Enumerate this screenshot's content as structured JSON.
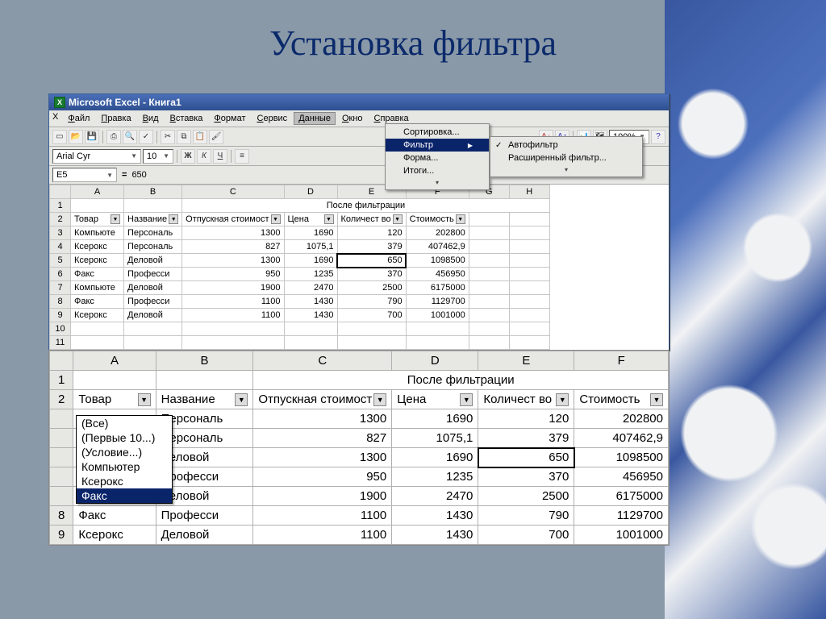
{
  "slide": {
    "title": "Установка фильтра"
  },
  "app": {
    "title": "Microsoft Excel - Книга1",
    "menu": [
      "Файл",
      "Правка",
      "Вид",
      "Вставка",
      "Формат",
      "Сервис",
      "Данные",
      "Окно",
      "Справка"
    ],
    "active_menu_index": 6,
    "font_name": "Arial Cyr",
    "font_size": "10",
    "zoom": "100%",
    "namebox": "E5",
    "formula_value": "650"
  },
  "data_menu": {
    "items": [
      {
        "label": "Сортировка..."
      },
      {
        "label": "Фильтр",
        "submenu": true,
        "highlight": true
      },
      {
        "label": "Форма..."
      },
      {
        "label": "Итоги..."
      }
    ],
    "submenu": [
      {
        "label": "Автофильтр",
        "checked": true
      },
      {
        "label": "Расширенный фильтр..."
      }
    ]
  },
  "sheet1": {
    "cols": [
      "A",
      "B",
      "C",
      "D",
      "E",
      "F",
      "G",
      "H"
    ],
    "title_row": "После фильтрации",
    "headers": [
      "Товар",
      "Название",
      "Отпускная стоимост",
      "Цена",
      "Количест во",
      "Стоимость"
    ],
    "rows": [
      {
        "n": "3",
        "товар": "Компьюте",
        "название": "Персональ",
        "отп": "1300",
        "цена": "1690",
        "кол": "120",
        "стоим": "202800"
      },
      {
        "n": "4",
        "товар": "Ксерокс",
        "название": "Персональ",
        "отп": "827",
        "цена": "1075,1",
        "кол": "379",
        "стоим": "407462,9"
      },
      {
        "n": "5",
        "товар": "Ксерокс",
        "название": "Деловой",
        "отп": "1300",
        "цена": "1690",
        "кол": "650",
        "стоим": "1098500",
        "selected": true
      },
      {
        "n": "6",
        "товар": "Факс",
        "название": "Професси",
        "отп": "950",
        "цена": "1235",
        "кол": "370",
        "стоим": "456950"
      },
      {
        "n": "7",
        "товар": "Компьюте",
        "название": "Деловой",
        "отп": "1900",
        "цена": "2470",
        "кол": "2500",
        "стоим": "6175000"
      },
      {
        "n": "8",
        "товар": "Факс",
        "название": "Професси",
        "отп": "1100",
        "цена": "1430",
        "кол": "790",
        "стоим": "1129700"
      },
      {
        "n": "9",
        "товар": "Ксерокс",
        "название": "Деловой",
        "отп": "1100",
        "цена": "1430",
        "кол": "700",
        "стоим": "1001000"
      }
    ],
    "blank_rows": [
      "10",
      "11"
    ]
  },
  "sheet2": {
    "cols": [
      "A",
      "B",
      "C",
      "D",
      "E",
      "F"
    ],
    "title_row": "После фильтрации",
    "headers": [
      "Товар",
      "Название",
      "Отпускная стоимост",
      "Цена",
      "Количест во",
      "Стоимость"
    ],
    "filter_list": [
      "(Все)",
      "(Первые 10...)",
      "(Условие...)",
      "Компьютер",
      "Ксерокс",
      "Факс"
    ],
    "filter_hl_index": 5,
    "rows": [
      {
        "n": "",
        "название": "Персональ",
        "отп": "1300",
        "цена": "1690",
        "кол": "120",
        "стоим": "202800"
      },
      {
        "n": "",
        "название": "Персональ",
        "отп": "827",
        "цена": "1075,1",
        "кол": "379",
        "стоим": "407462,9"
      },
      {
        "n": "",
        "название": "Деловой",
        "отп": "1300",
        "цена": "1690",
        "кол": "650",
        "стоим": "1098500",
        "selected": true
      },
      {
        "n": "",
        "название": "Професси",
        "отп": "950",
        "цена": "1235",
        "кол": "370",
        "стоим": "456950"
      },
      {
        "n": "",
        "название": "Деловой",
        "отп": "1900",
        "цена": "2470",
        "кол": "2500",
        "стоим": "6175000"
      },
      {
        "n": "8",
        "товар": "Факс",
        "название": "Професси",
        "отп": "1100",
        "цена": "1430",
        "кол": "790",
        "стоим": "1129700"
      },
      {
        "n": "9",
        "товар": "Ксерокс",
        "название": "Деловой",
        "отп": "1100",
        "цена": "1430",
        "кол": "700",
        "стоим": "1001000"
      }
    ]
  }
}
